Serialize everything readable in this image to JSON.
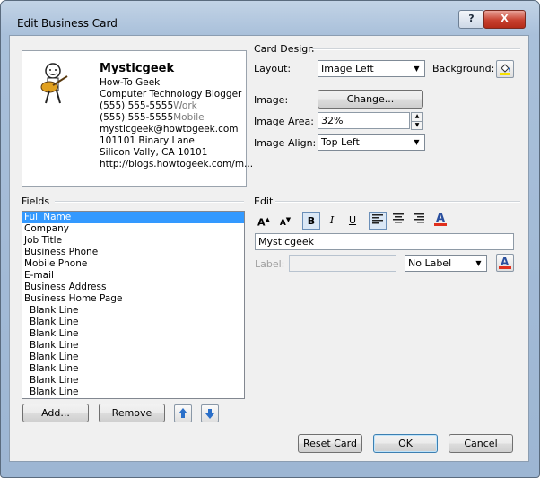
{
  "window": {
    "title": "Edit Business Card",
    "help_glyph": "?",
    "close_glyph": "X"
  },
  "preview": {
    "name": "Mysticgeek",
    "lines": [
      {
        "text": "How-To Geek",
        "label": ""
      },
      {
        "text": "Computer Technology Blogger",
        "label": ""
      },
      {
        "text": "(555) 555-5555",
        "label": "Work"
      },
      {
        "text": "(555) 555-5555",
        "label": "Mobile"
      },
      {
        "text": "mysticgeek@howtogeek.com",
        "label": ""
      },
      {
        "text": "101101 Binary Lane",
        "label": ""
      },
      {
        "text": "Silicon Vally, CA  10101",
        "label": ""
      },
      {
        "text": "http://blogs.howtogeek.com/m...",
        "label": ""
      }
    ]
  },
  "card_design": {
    "header": "Card Design",
    "layout_label": "Layout:",
    "layout_value": "Image Left",
    "background_label": "Background:",
    "image_label": "Image:",
    "change_button": "Change...",
    "image_area_label": "Image Area:",
    "image_area_value": "32%",
    "image_align_label": "Image Align:",
    "image_align_value": "Top Left"
  },
  "fields": {
    "header": "Fields",
    "items": [
      "Full Name",
      "Company",
      "Job Title",
      "Business Phone",
      "Mobile Phone",
      "E-mail",
      "Business Address",
      "Business Home Page",
      "Blank Line",
      "Blank Line",
      "Blank Line",
      "Blank Line",
      "Blank Line",
      "Blank Line",
      "Blank Line",
      "Blank Line"
    ],
    "selected_index": 0,
    "add_button": "Add...",
    "remove_button": "Remove"
  },
  "edit": {
    "header": "Edit",
    "text_value": "Mysticgeek",
    "label_label": "Label:",
    "label_value": "",
    "label_position": "No Label"
  },
  "buttons": {
    "reset": "Reset Card",
    "ok": "OK",
    "cancel": "Cancel"
  },
  "colors": {
    "selection": "#3399ff",
    "font_color_bar": "#e0301e",
    "title_bar": "#a9c0da"
  }
}
